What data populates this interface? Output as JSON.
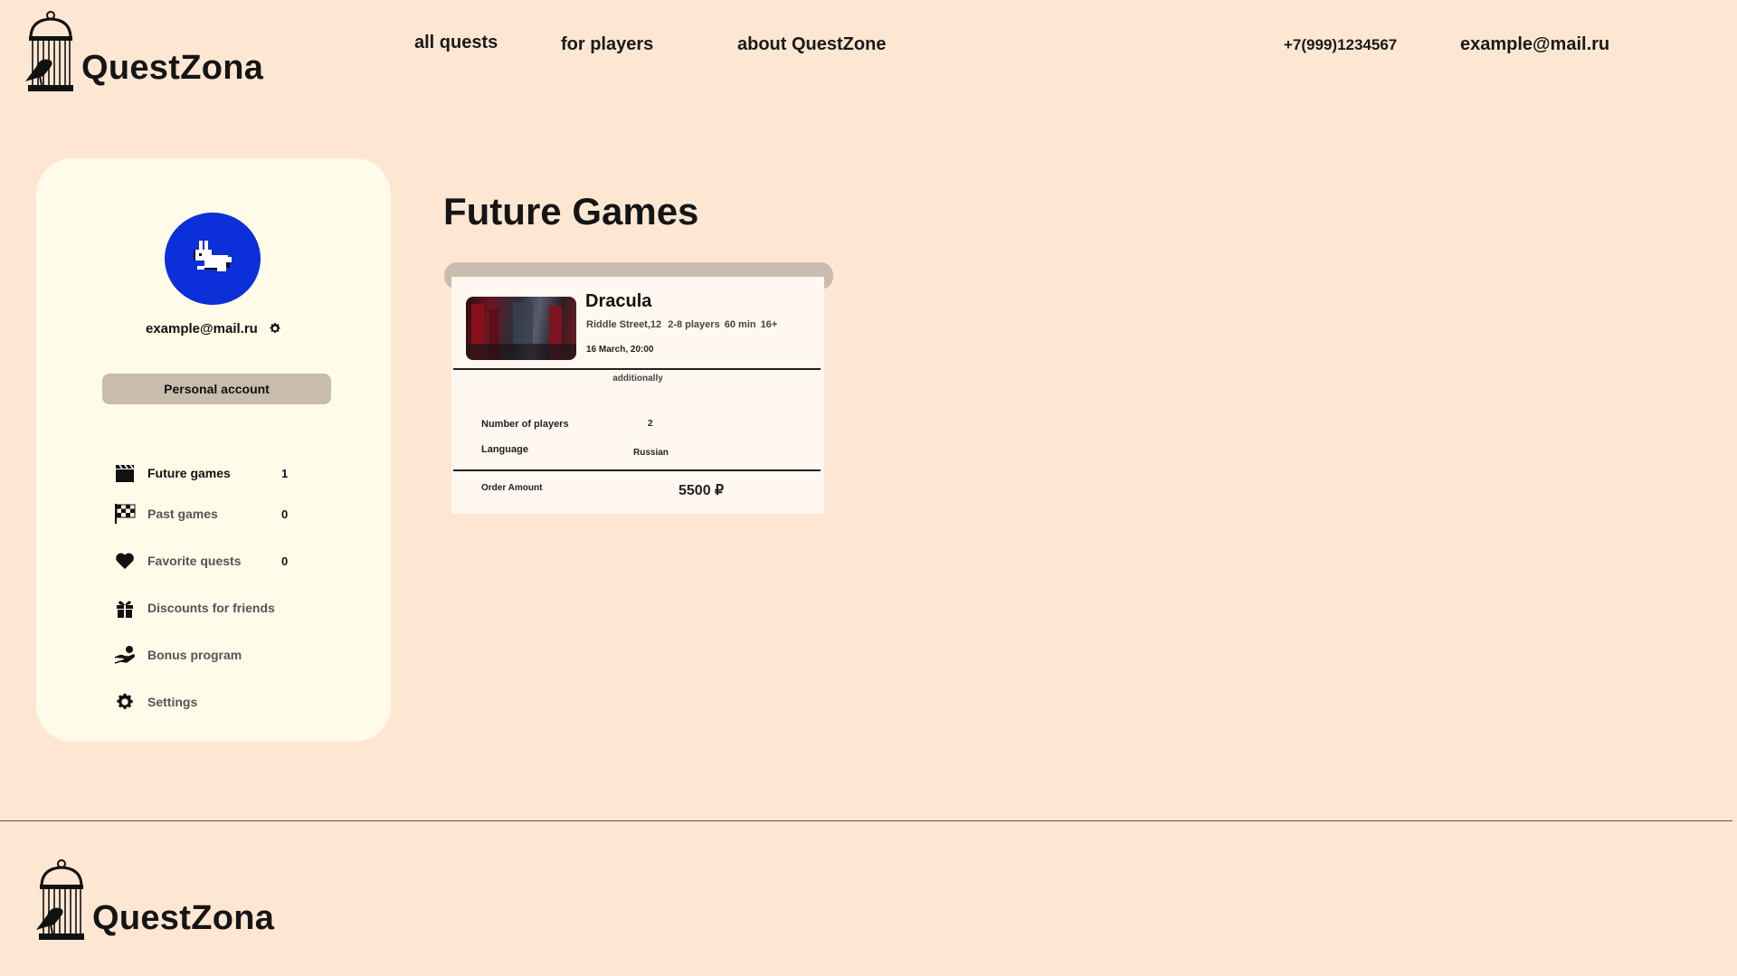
{
  "header": {
    "brand": "QuestZona",
    "nav": [
      {
        "label": "all quests"
      },
      {
        "label": "for players"
      },
      {
        "label": "about QuestZone"
      }
    ],
    "phone": "+7(999)1234567",
    "email": "example@mail.ru"
  },
  "sidebar": {
    "avatar_icon": "rabbit-icon",
    "avatar_color": "#0b2fd8",
    "user_email": "example@mail.ru",
    "personal_account_label": "Personal account",
    "items": [
      {
        "label": "Future games",
        "count": "1",
        "icon": "clapperboard-icon"
      },
      {
        "label": "Past games",
        "count": "0",
        "icon": "checkered-flag-icon"
      },
      {
        "label": "Favorite quests",
        "count": "0",
        "icon": "heart-icon"
      },
      {
        "label": "Discounts for friends",
        "count": "",
        "icon": "gift-icon"
      },
      {
        "label": "Bonus program",
        "count": "",
        "icon": "hand-coin-icon"
      },
      {
        "label": "Settings",
        "count": "",
        "icon": "gear-icon"
      }
    ]
  },
  "main": {
    "title": "Future Games",
    "booking": {
      "quest_name": "Dracula",
      "address": "Riddle Street,12",
      "players_range": "2-8 players",
      "duration": "60 min",
      "age": "16+",
      "datetime": "16 March, 20:00",
      "additionally_label": "additionally",
      "players_label": "Number of players",
      "players_value": "2",
      "language_label": "Language",
      "language_value": "Russian",
      "amount_label": "Order Amount",
      "amount_value": "5500 ₽"
    }
  },
  "footer": {
    "brand": "QuestZona"
  },
  "colors": {
    "background": "#fde7d3",
    "sidebar_bg": "#fefbe9",
    "button_bg": "#c9bcad",
    "accent_blue": "#0b2fd8"
  }
}
